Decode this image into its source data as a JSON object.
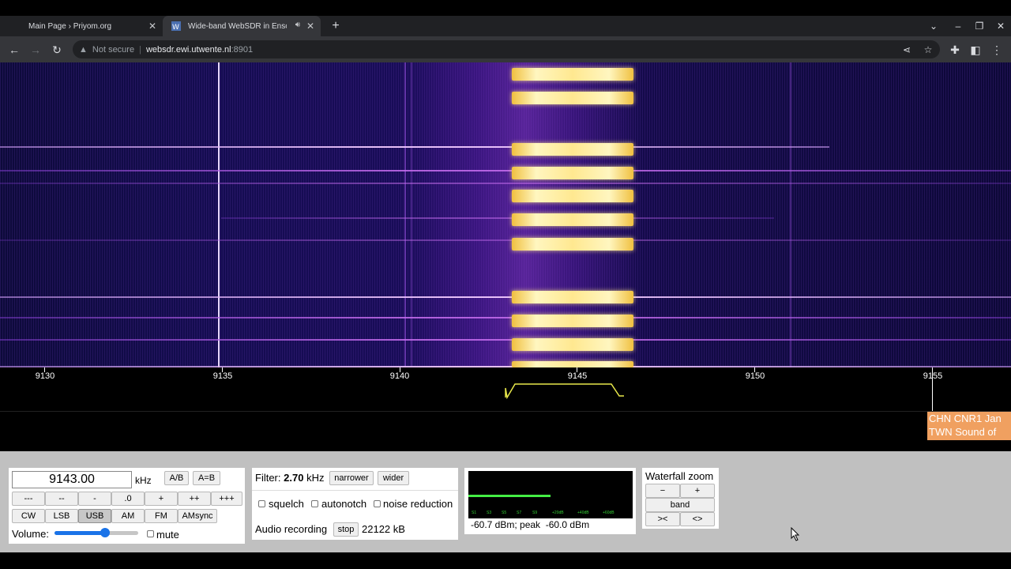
{
  "browser": {
    "tabs": [
      {
        "title": "Main Page › Priyom.org",
        "active": false
      },
      {
        "title": "Wide-band WebSDR in Ensch",
        "active": true,
        "audio_playing": true
      }
    ],
    "address": {
      "security_label": "Not secure",
      "host": "websdr.ewi.utwente.nl",
      "port": ":8901"
    }
  },
  "waterfall": {
    "colors": {
      "background": "#0c0830",
      "signal": "#fff6c0",
      "line": "#c86ef0"
    }
  },
  "scale": {
    "ticks": [
      "9130",
      "9135",
      "9140",
      "9145",
      "9150",
      "9155"
    ]
  },
  "station_labels": [
    "CHN CNR1 Jan",
    "TWN Sound of"
  ],
  "frequency": {
    "value": "9143.00",
    "unit": "kHz",
    "ab_label": "A/B",
    "aeqb_label": "A=B",
    "step_buttons": [
      "---",
      "--",
      "-",
      ".0",
      "+",
      "++",
      "+++"
    ],
    "modes": [
      "CW",
      "LSB",
      "USB",
      "AM",
      "FM",
      "AMsync"
    ],
    "active_mode": "USB",
    "volume_label": "Volume:",
    "volume_level": 0.6,
    "mute_label": "mute"
  },
  "filter": {
    "label": "Filter:",
    "bandwidth": "2.70",
    "unit": "kHz",
    "narrower_label": "narrower",
    "wider_label": "wider",
    "options": [
      "squelch",
      "autonotch",
      "noise reduction"
    ],
    "recording_label": "Audio recording",
    "stop_label": "stop",
    "recording_size": "22122 kB"
  },
  "smeter": {
    "readout": "-60.7 dBm; peak  -60.0 dBm",
    "scale_marks": [
      "S1",
      "S3",
      "S5",
      "S7",
      "S9",
      "+20dB",
      "+40dB",
      "+60dB"
    ],
    "level": 0.5
  },
  "zoom": {
    "title": "Waterfall zoom",
    "minus_label": "−",
    "plus_label": "+",
    "band_label": "band",
    "narrow_label": "><",
    "wide_label": "<>"
  }
}
